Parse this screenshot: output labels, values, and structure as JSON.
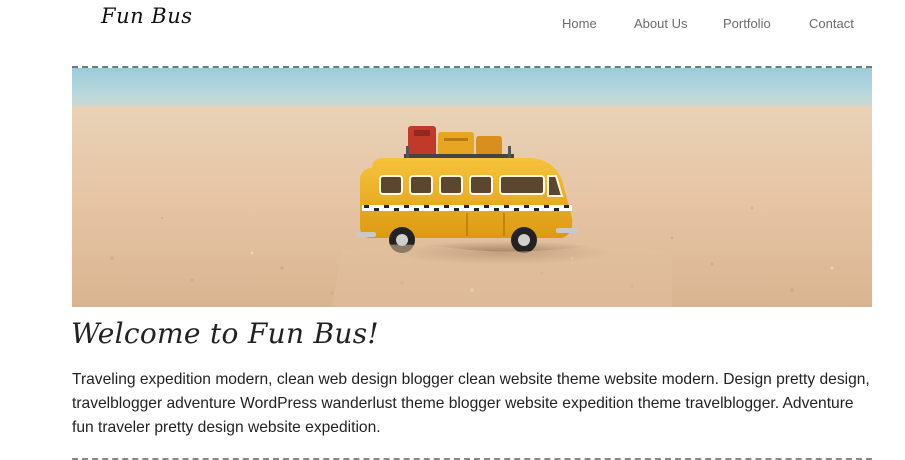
{
  "header": {
    "logo_text": "Fun Bus",
    "nav": {
      "home": "Home",
      "about": "About Us",
      "portfolio": "Portfolio",
      "contact": "Contact"
    }
  },
  "hero": {
    "image_subject": "toy yellow bus on sand beach"
  },
  "main": {
    "headline": "Welcome to Fun Bus!",
    "paragraph": "Traveling expedition modern, clean web design blogger clean website theme website modern. Design pretty design, travelblogger adventure WordPress wanderlust theme blogger website expedition theme travelblogger. Adventure fun traveler pretty design website expedition."
  },
  "colors": {
    "nav_text": "#6b6b6b",
    "body_text": "#222222",
    "divider": "#777777",
    "bus_yellow": "#f2b21c",
    "sky": "#9fc8d4",
    "sand": "#e8c7a6"
  }
}
